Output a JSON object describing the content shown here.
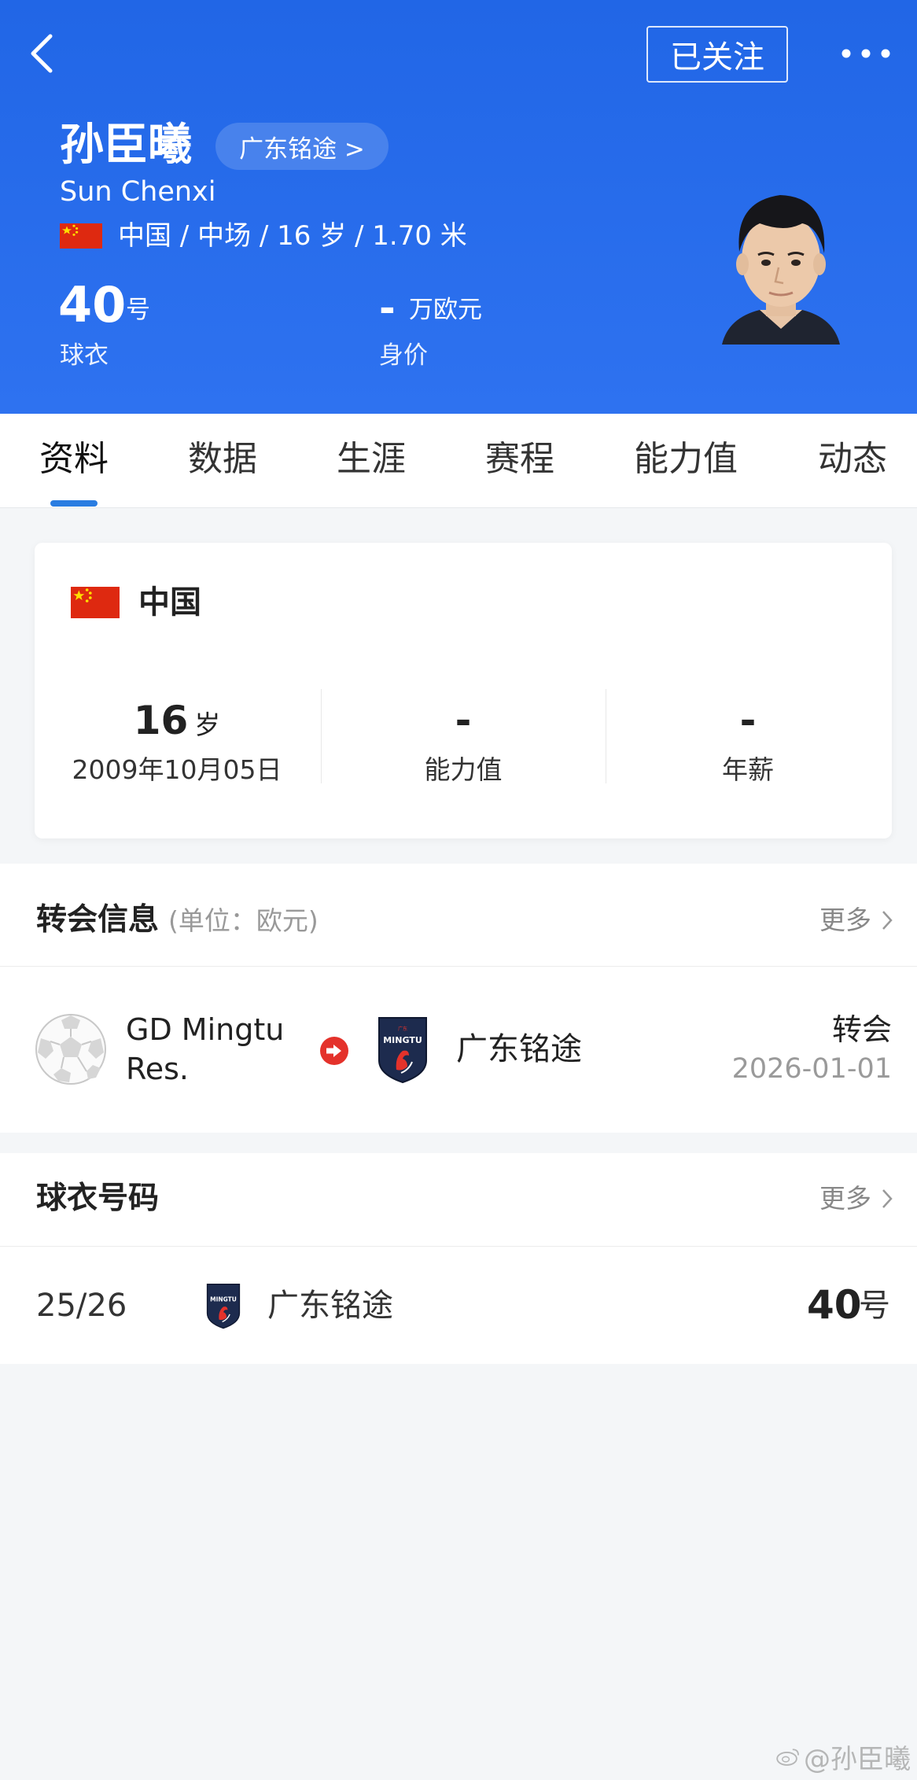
{
  "header": {
    "follow_label": "已关注",
    "player_name": "孙臣曦",
    "team_chip": "广东铭途 >",
    "player_name_en": "Sun Chenxi",
    "meta": "中国 / 中场 / 16 岁 / 1.70 米",
    "shirt_number": "40",
    "shirt_unit": "号",
    "shirt_label": "球衣",
    "market_value": "-",
    "market_value_unit": "万欧元",
    "market_value_label": "身价"
  },
  "tabs": [
    {
      "label": "资料",
      "active": true
    },
    {
      "label": "数据",
      "active": false
    },
    {
      "label": "生涯",
      "active": false
    },
    {
      "label": "赛程",
      "active": false
    },
    {
      "label": "能力值",
      "active": false
    },
    {
      "label": "动态",
      "active": false
    }
  ],
  "profile_card": {
    "country": "中国",
    "age": "16",
    "age_unit": "岁",
    "birth_date": "2009年10月05日",
    "ability": "-",
    "ability_label": "能力值",
    "salary": "-",
    "salary_label": "年薪"
  },
  "transfer_section": {
    "title": "转会信息",
    "subtitle": "(单位：欧元)",
    "more_label": "更多",
    "from_team_line1": "GD Mingtu",
    "from_team_line2": "Res.",
    "to_team": "广东铭途",
    "type": "转会",
    "date": "2026-01-01"
  },
  "shirt_section": {
    "title": "球衣号码",
    "more_label": "更多",
    "season": "25/26",
    "team": "广东铭途",
    "number": "40",
    "number_unit": "号"
  },
  "watermark": "@孙臣曦",
  "colors": {
    "header_blue": "#2166e6",
    "tab_indicator": "#2a7de1",
    "transfer_arrow": "#e4322b",
    "flag_red": "#de2910",
    "flag_star": "#ffde00",
    "crest_navy": "#1d2b4e"
  },
  "icons": {
    "back": "chevron-left-icon",
    "more": "ellipsis-icon",
    "flag": "china-flag-icon",
    "transfer": "arrow-circle-right-icon",
    "placeholder_club": "soccer-ball-icon",
    "club": "mingtu-crest-icon",
    "more_chevron": "chevron-right-icon"
  }
}
